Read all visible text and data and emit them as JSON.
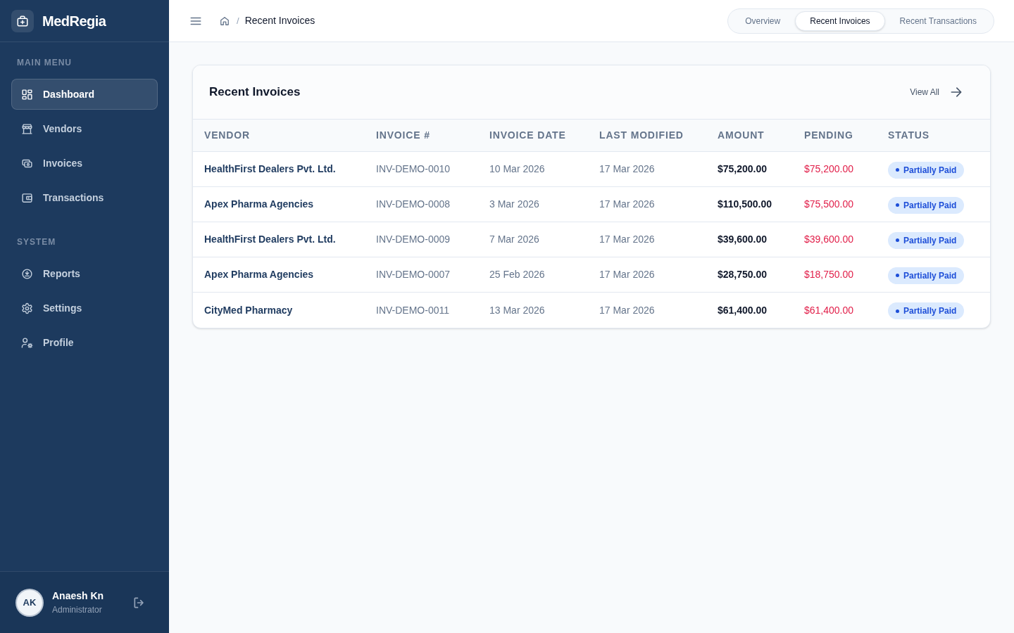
{
  "brand": {
    "name": "MedRegia"
  },
  "sidebar": {
    "sections": [
      {
        "title": "MAIN MENU",
        "items": [
          {
            "label": "Dashboard",
            "selected": true
          },
          {
            "label": "Vendors",
            "selected": false
          },
          {
            "label": "Invoices",
            "selected": false
          },
          {
            "label": "Transactions",
            "selected": false
          }
        ]
      },
      {
        "title": "SYSTEM",
        "items": [
          {
            "label": "Reports",
            "selected": false
          },
          {
            "label": "Settings",
            "selected": false
          },
          {
            "label": "Profile",
            "selected": false
          }
        ]
      }
    ]
  },
  "user": {
    "initials": "AK",
    "name": "Anaesh Kn",
    "role": "Administrator"
  },
  "breadcrumb": {
    "separator": "/",
    "current": "Recent Invoices"
  },
  "tabs": [
    {
      "label": "Overview",
      "selected": false
    },
    {
      "label": "Recent Invoices",
      "selected": true
    },
    {
      "label": "Recent Transactions",
      "selected": false
    }
  ],
  "card": {
    "title": "Recent Invoices",
    "link": "View All",
    "table": {
      "columns": [
        "VENDOR",
        "INVOICE #",
        "INVOICE DATE",
        "LAST MODIFIED",
        "AMOUNT",
        "PENDING",
        "STATUS"
      ],
      "rows": [
        {
          "vendor": "HealthFirst Dealers Pvt. Ltd.",
          "invoice": "INV-DEMO-0010",
          "invoice_date": "10 Mar 2026",
          "last_modified": "17 Mar 2026",
          "amount": "$75,200.00",
          "pending": "$75,200.00",
          "status": "Partially Paid"
        },
        {
          "vendor": "Apex Pharma Agencies",
          "invoice": "INV-DEMO-0008",
          "invoice_date": "3 Mar 2026",
          "last_modified": "17 Mar 2026",
          "amount": "$110,500.00",
          "pending": "$75,500.00",
          "status": "Partially Paid"
        },
        {
          "vendor": "HealthFirst Dealers Pvt. Ltd.",
          "invoice": "INV-DEMO-0009",
          "invoice_date": "7 Mar 2026",
          "last_modified": "17 Mar 2026",
          "amount": "$39,600.00",
          "pending": "$39,600.00",
          "status": "Partially Paid"
        },
        {
          "vendor": "Apex Pharma Agencies",
          "invoice": "INV-DEMO-0007",
          "invoice_date": "25 Feb 2026",
          "last_modified": "17 Mar 2026",
          "amount": "$28,750.00",
          "pending": "$18,750.00",
          "status": "Partially Paid"
        },
        {
          "vendor": "CityMed Pharmacy",
          "invoice": "INV-DEMO-0011",
          "invoice_date": "13 Mar 2026",
          "last_modified": "17 Mar 2026",
          "amount": "$61,400.00",
          "pending": "$61,400.00",
          "status": "Partially Paid"
        }
      ]
    }
  }
}
